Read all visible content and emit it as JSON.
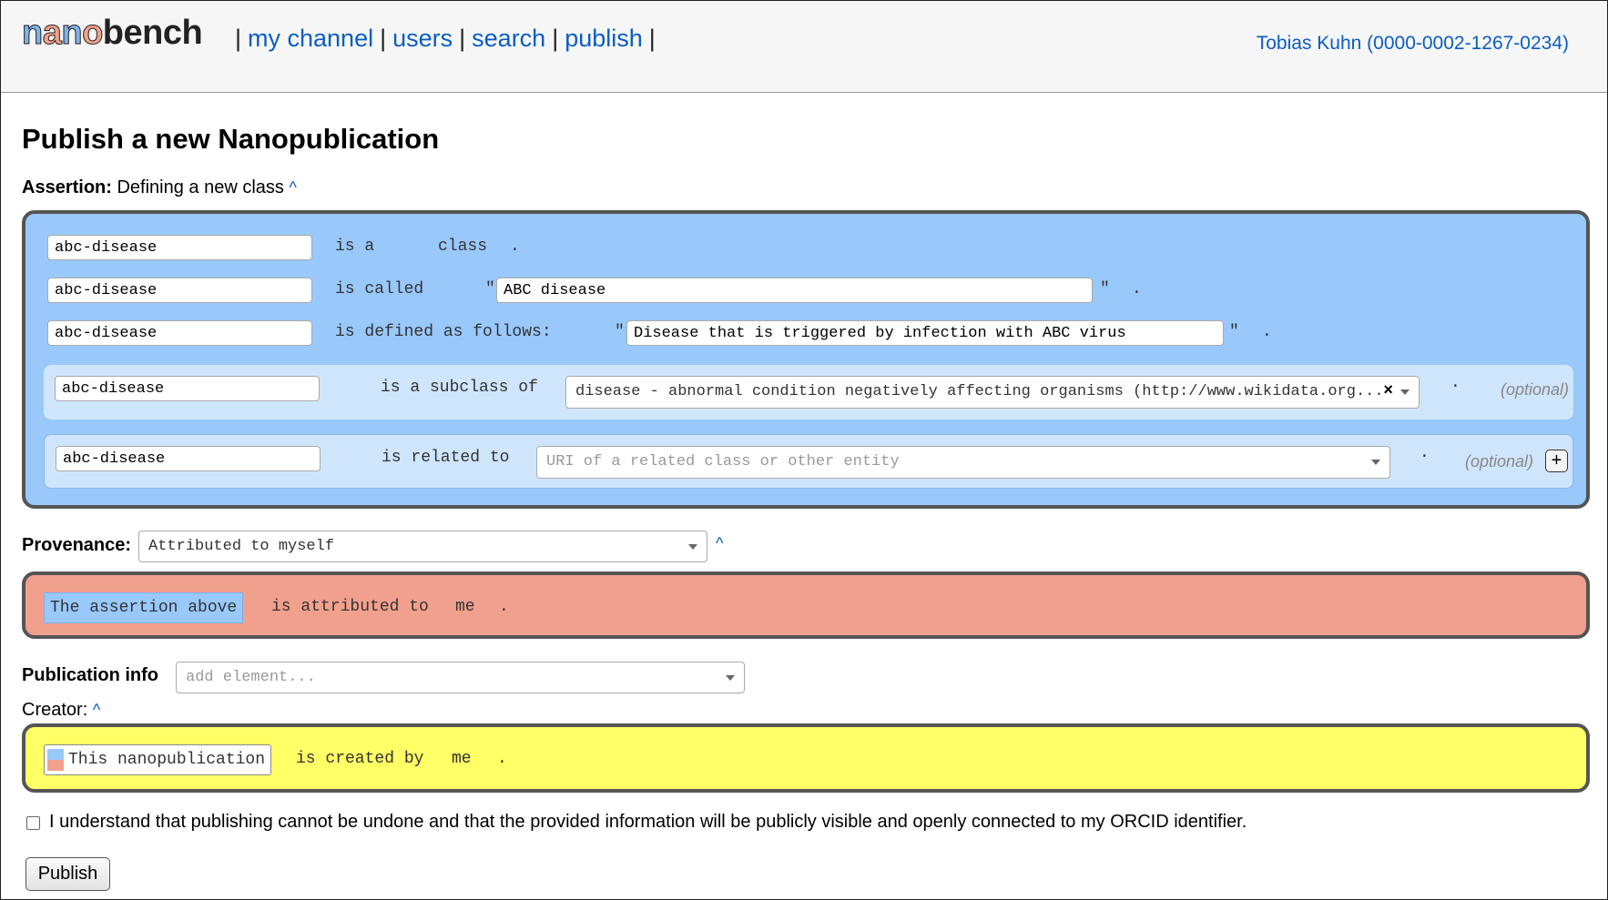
{
  "header": {
    "logo_parts": [
      "n",
      "a",
      "n",
      "o",
      "bench"
    ],
    "nav": [
      "my channel",
      "users",
      "search",
      "publish"
    ],
    "user": "Tobias Kuhn (0000-0002-1267-0234)"
  },
  "page_title": "Publish a new Nanopublication",
  "assertion": {
    "label": "Assertion:",
    "template": "Defining a new class",
    "caret": "^",
    "rows": [
      {
        "subject": "abc-disease",
        "pred": "is a",
        "object": "class",
        "end": "."
      },
      {
        "subject": "abc-disease",
        "pred": "is called",
        "open_quote": "\"",
        "value": "ABC disease",
        "close_quote": "\"",
        "end": "."
      },
      {
        "subject": "abc-disease",
        "pred": "is defined as follows:",
        "open_quote": "\"",
        "value": "Disease that is triggered by infection with ABC virus",
        "close_quote": "\"",
        "end": "."
      }
    ],
    "subclass": {
      "subject": "abc-disease",
      "pred": "is a subclass of",
      "value": "disease - abnormal condition negatively affecting organisms (http://www.wikidata.org...",
      "clear": "×",
      "end": "·",
      "optional": "(optional)"
    },
    "related": {
      "subject": "abc-disease",
      "pred": "is related to",
      "placeholder": "URI of a related class or other entity",
      "end": "·",
      "optional": "(optional)",
      "add": "+"
    }
  },
  "provenance": {
    "label": "Provenance:",
    "select_value": "Attributed to myself",
    "caret": "^",
    "chip": "The assertion above",
    "pred": "is attributed to",
    "object": "me",
    "end": "."
  },
  "pubinfo": {
    "label": "Publication info",
    "select_placeholder": "add element...",
    "creator_label": "Creator:",
    "caret": "^",
    "chip": "This nanopublication",
    "pred": "is created by",
    "object": "me",
    "end": "."
  },
  "confirm_text": "I understand that publishing cannot be undone and that the provided information will be publicly visible and openly connected to my ORCID identifier.",
  "publish_label": "Publish",
  "colors": {
    "assertion": "#99c8fb",
    "provenance": "#f2a08e",
    "pubinfo": "#ffff66",
    "link": "#0a5ec2"
  }
}
